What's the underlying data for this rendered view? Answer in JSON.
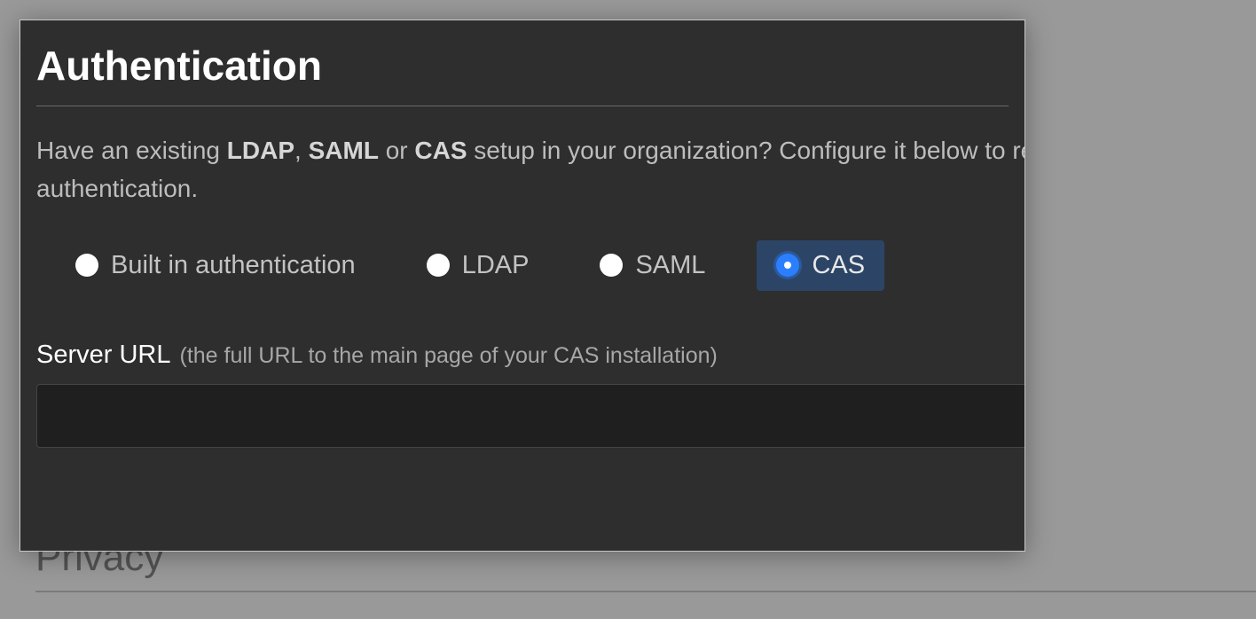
{
  "background": {
    "section_title": "Privacy"
  },
  "modal": {
    "title": "Authentication",
    "desc_prefix": "Have an existing ",
    "desc_b1": "LDAP",
    "desc_sep1": ", ",
    "desc_b2": "SAML",
    "desc_sep2": " or ",
    "desc_b3": "CAS",
    "desc_suffix": " setup in your organization? Configure it below to replace the built in authentication.",
    "radios": {
      "builtin": "Built in authentication",
      "ldap": "LDAP",
      "saml": "SAML",
      "cas": "CAS",
      "selected": "cas"
    },
    "field": {
      "label": "Server URL",
      "hint": "(the full URL to the main page of your CAS installation)",
      "value": ""
    }
  }
}
